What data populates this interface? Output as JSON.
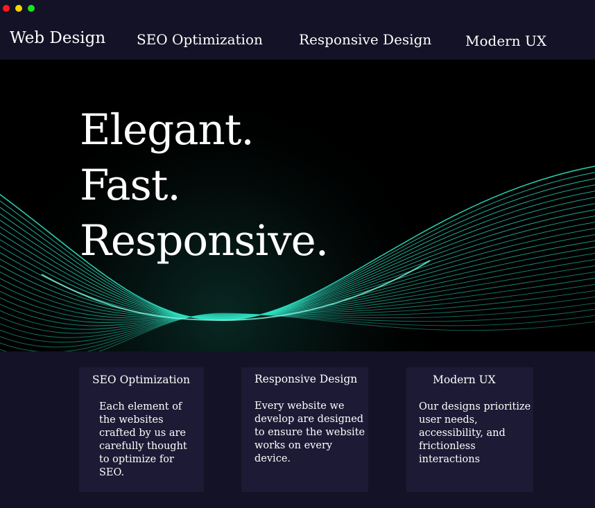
{
  "nav": {
    "brand": "Web Design",
    "items": [
      {
        "label": "SEO Optimization"
      },
      {
        "label": "Responsive Design"
      },
      {
        "label": "Modern UX"
      }
    ]
  },
  "hero": {
    "lines": [
      "Elegant.",
      "Fast.",
      "Responsive."
    ],
    "accent_color": "#2de0c0"
  },
  "cards": [
    {
      "title": "SEO Optimization",
      "body": "Each element of the websites crafted by us are carefully thought to optimize for SEO."
    },
    {
      "title": "Responsive Design",
      "body": "Every website we develop are designed to ensure the website works on every device."
    },
    {
      "title": "Modern UX",
      "body": "Our designs prioritize user needs, accessibility, and frictionless interactions"
    }
  ],
  "colors": {
    "background": "#141226",
    "card": "#1c1a34",
    "hero": "#000000",
    "window_red": "#ff1a1a",
    "window_yellow": "#f2d600",
    "window_green": "#19e619"
  }
}
